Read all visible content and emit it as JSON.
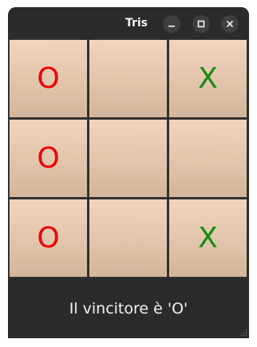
{
  "window": {
    "title": "Tris"
  },
  "titlebar_buttons": {
    "minimize_icon": "minimize-icon",
    "maximize_icon": "maximize-icon",
    "close_icon": "close-icon"
  },
  "board": {
    "cells": [
      "O",
      "",
      "X",
      "O",
      "",
      "",
      "O",
      "",
      "X"
    ],
    "colors": {
      "O": "#ee0000",
      "X": "#118c11",
      "cell_top": "#f2d4bd",
      "cell_bottom": "#d2b59b"
    }
  },
  "status": {
    "text": "Il vincitore è 'O'"
  }
}
